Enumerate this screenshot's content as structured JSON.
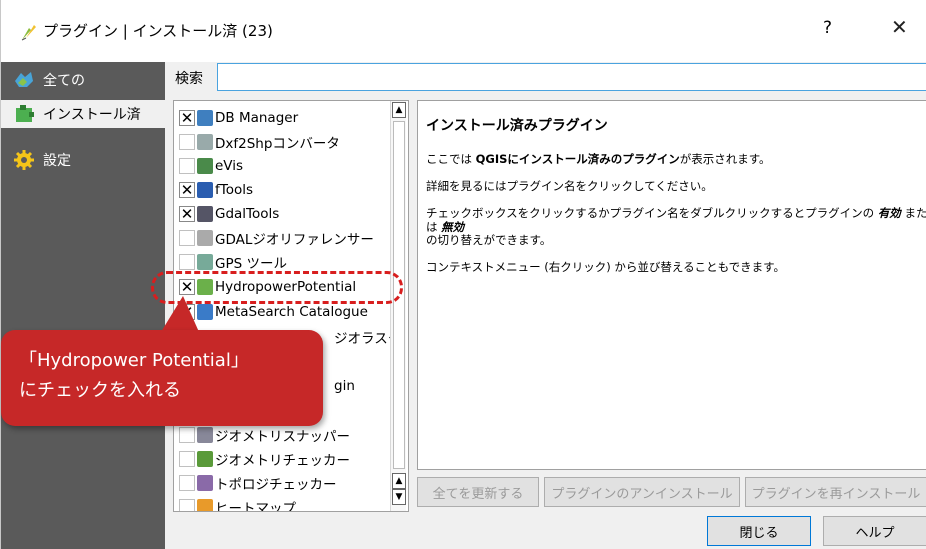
{
  "window": {
    "title": "プラグイン | インストール済 (23)",
    "help_glyph": "?",
    "close_glyph": "✕"
  },
  "sidebar": {
    "items": [
      {
        "label": "全ての",
        "icon": "all-plugins-icon"
      },
      {
        "label": "インストール済",
        "icon": "installed-plugins-icon"
      },
      {
        "label": "設定",
        "icon": "settings-gear-icon"
      }
    ],
    "active_index": 1
  },
  "search": {
    "label": "検索",
    "value": ""
  },
  "plugins": [
    {
      "name": "DB Manager",
      "checked": true,
      "icon": "db-manager-icon"
    },
    {
      "name": "Dxf2Shpコンバータ",
      "checked": false,
      "icon": "dxf2shp-icon"
    },
    {
      "name": "eVis",
      "checked": false,
      "icon": "evis-icon"
    },
    {
      "name": "fTools",
      "checked": true,
      "icon": "ftools-icon"
    },
    {
      "name": "GdalTools",
      "checked": true,
      "icon": "gdaltools-icon"
    },
    {
      "name": "GDALジオリファレンサー",
      "checked": false,
      "icon": "georeferencer-icon"
    },
    {
      "name": "GPS ツール",
      "checked": false,
      "icon": "gps-icon"
    },
    {
      "name": "HydropowerPotential",
      "checked": true,
      "icon": "hydropower-icon"
    },
    {
      "name": "MetaSearch Catalogue",
      "checked": true,
      "icon": "metasearch-icon"
    },
    {
      "name": "ジオメトリスナッパー",
      "checked": false,
      "icon": "geometry-snapper-icon"
    },
    {
      "name": "ジオメトリチェッカー",
      "checked": false,
      "icon": "geometry-checker-icon"
    },
    {
      "name": "トポロジチェッカー",
      "checked": false,
      "icon": "topology-checker-icon"
    },
    {
      "name": "ヒートマップ",
      "checked": false,
      "icon": "heatmap-icon"
    }
  ],
  "partial_rows": {
    "raster_suffix": "ジオラスタ",
    "plugin_suffix": "gin"
  },
  "info": {
    "heading": "インストール済みプラグイン",
    "p1_prefix": "ここでは ",
    "p1_bold": "QGISにインストール済みのプラグイン",
    "p1_suffix": "が表示されます。",
    "p2": "詳細を見るにはプラグイン名をクリックしてください。",
    "p3_prefix": "チェックボックスをクリックするかプラグイン名をダブルクリックするとプラグインの ",
    "p3_em1": "有効",
    "p3_mid": " または ",
    "p3_em2": "無効",
    "p3_suffix": "\nの切り替えができます。",
    "p4": "コンテキストメニュー (右クリック) から並び替えることもできます。"
  },
  "buttons": {
    "upgrade_all": "全てを更新する",
    "uninstall": "プラグインのアンインストール",
    "reinstall": "プラグインを再インストール",
    "close": "閉じる",
    "help": "ヘルプ"
  },
  "callout": {
    "text": "「Hydropower Potential」\nにチェックを入れる"
  },
  "colors": {
    "sidebar": "#5a5a5a",
    "callout": "#c62828",
    "highlight": "#d81e1e",
    "focus": "#4aa3df"
  }
}
